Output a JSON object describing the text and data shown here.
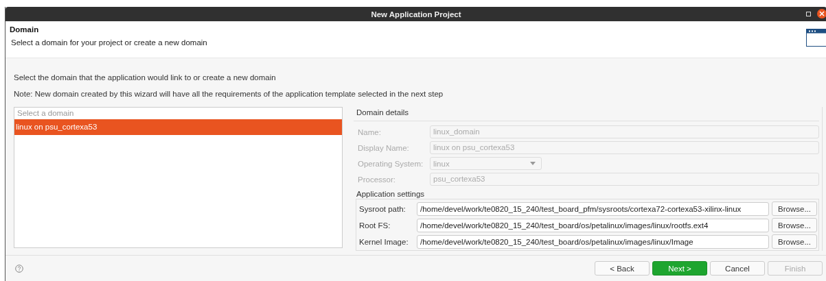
{
  "window": {
    "title": "New Application Project"
  },
  "header": {
    "title": "Domain",
    "subtitle": "Select a domain for your project or create a new domain"
  },
  "instructions": [
    "Select the domain that the application would link to or create a new domain",
    "Note: New domain created by this wizard will have all the requirements of the application template selected in the next step"
  ],
  "domain_list": {
    "heading": "Select a domain",
    "items": [
      {
        "label": "linux on psu_cortexa53",
        "selected": true
      }
    ]
  },
  "domain_details": {
    "title": "Domain details",
    "fields": [
      {
        "label": "Name:",
        "value": "linux_domain",
        "kind": "text",
        "disabled": true
      },
      {
        "label": "Display Name:",
        "value": "linux on psu_cortexa53",
        "kind": "text",
        "disabled": true
      },
      {
        "label": "Operating System:",
        "value": "linux",
        "kind": "dropdown",
        "disabled": true
      },
      {
        "label": "Processor:",
        "value": "psu_cortexa53",
        "kind": "text",
        "disabled": true
      }
    ]
  },
  "application_settings": {
    "title": "Application settings",
    "rows": [
      {
        "label": "Sysroot path:",
        "value": "/home/devel/work/te0820_15_240/test_board_pfm/sysroots/cortexa72-cortexa53-xilinx-linux",
        "button": "Browse..."
      },
      {
        "label": "Root FS:",
        "value": "/home/devel/work/te0820_15_240/test_board/os/petalinux/images/linux/rootfs.ext4",
        "button": "Browse..."
      },
      {
        "label": "Kernel Image:",
        "value": "/home/devel/work/te0820_15_240/test_board/os/petalinux/images/linux/Image",
        "button": "Browse..."
      }
    ]
  },
  "footer": {
    "buttons": [
      {
        "label": "< Back",
        "primary": false,
        "disabled": false
      },
      {
        "label": "Next >",
        "primary": true,
        "disabled": false
      },
      {
        "label": "Cancel",
        "primary": false,
        "disabled": false
      },
      {
        "label": "Finish",
        "primary": false,
        "disabled": true
      }
    ]
  }
}
